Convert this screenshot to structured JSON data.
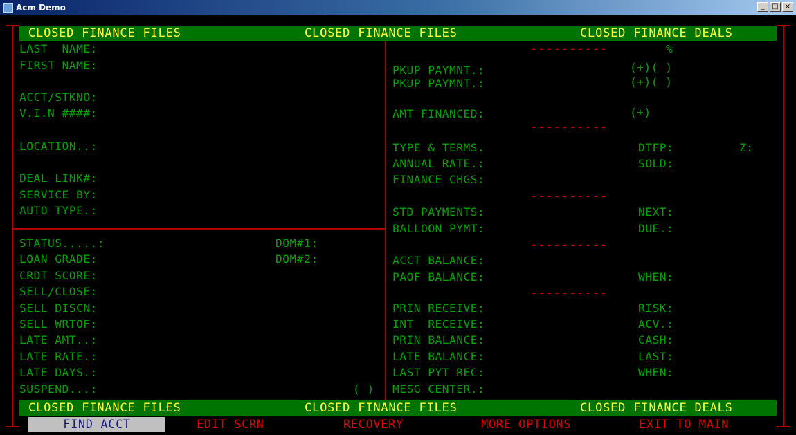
{
  "window": {
    "title": "Acm Demo",
    "controls": {
      "minimize": "_",
      "maximize": "□",
      "close": "×"
    }
  },
  "banner_top": {
    "left": "CLOSED FINANCE FILES",
    "center": "CLOSED FINANCE FILES",
    "right": "CLOSED FINANCE DEALS"
  },
  "banner_bottom": {
    "left": "CLOSED FINANCE FILES",
    "center": "CLOSED FINANCE FILES",
    "right": "CLOSED FINANCE DEALS"
  },
  "left_top": {
    "last_name": "LAST  NAME:",
    "first_name": "FIRST NAME:",
    "acct_stkno": "ACCT/STKNO:",
    "vin": "V.I.N ####:",
    "location": "LOCATION..:",
    "deal_link": "DEAL LINK#:",
    "service_by": "SERVICE BY:",
    "auto_type": "AUTO TYPE.:"
  },
  "left_bottom": {
    "status": "STATUS.....:",
    "loan_grade": "LOAN GRADE:",
    "crdt_score": "CRDT SCORE:",
    "sell_close": "SELL/CLOSE:",
    "sell_discn": "SELL DISCN:",
    "sell_wrtof": "SELL WRTOF:",
    "late_amt": "LATE AMT..:",
    "late_rate": "LATE RATE.:",
    "late_days": "LATE DAYS.:",
    "suspend": "SUSPEND...:",
    "suspend_flag": "( )",
    "dom1": "DOM#1:",
    "dom2": "DOM#2:"
  },
  "right": {
    "dashes": "----------",
    "percent": "%",
    "pkup1": "PKUP PAYMNT.:",
    "pkup1_flag": "(+)( )",
    "pkup2": "PKUP PAYMNT.:",
    "pkup2_flag": "(+)( )",
    "amt_financed": "AMT FINANCED:",
    "amt_financed_flag": "(+)",
    "type_terms": "TYPE & TERMS.",
    "dtfp": "DTFP:",
    "z": "Z:",
    "annual_rate": "ANNUAL RATE.:",
    "sold": "SOLD:",
    "finance_chgs": "FINANCE CHGS:",
    "std_payments": "STD PAYMENTS:",
    "next": "NEXT:",
    "balloon_pymt": "BALLOON PYMT:",
    "due": "DUE.:",
    "acct_balance": "ACCT BALANCE:",
    "paof_balance": "PAOF BALANCE:",
    "when1": "WHEN:",
    "prin_receive": "PRIN RECEIVE:",
    "risk": "RISK:",
    "int_receive": "INT  RECEIVE:",
    "acv": "ACV.:",
    "prin_balance": "PRIN BALANCE:",
    "cash": "CASH:",
    "late_balance": "LATE BALANCE:",
    "last": "LAST:",
    "last_pyt_rec": "LAST PYT REC:",
    "when2": "WHEN:",
    "mesg_center": "MESG CENTER.:"
  },
  "menu": {
    "find_acct": "FIND ACCT",
    "edit_scrn": "EDIT SCRN",
    "recovery": "RECOVERY",
    "more_options": "MORE OPTIONS",
    "exit_to_main": "EXIT TO MAIN"
  },
  "colors": {
    "background": "#000000",
    "label_green": "#00a400",
    "banner_bg": "#007400",
    "banner_text": "#ffff3c",
    "border_red": "#b40000",
    "menu_red": "#e00000",
    "menu_selected_bg": "#c0c0c0"
  }
}
